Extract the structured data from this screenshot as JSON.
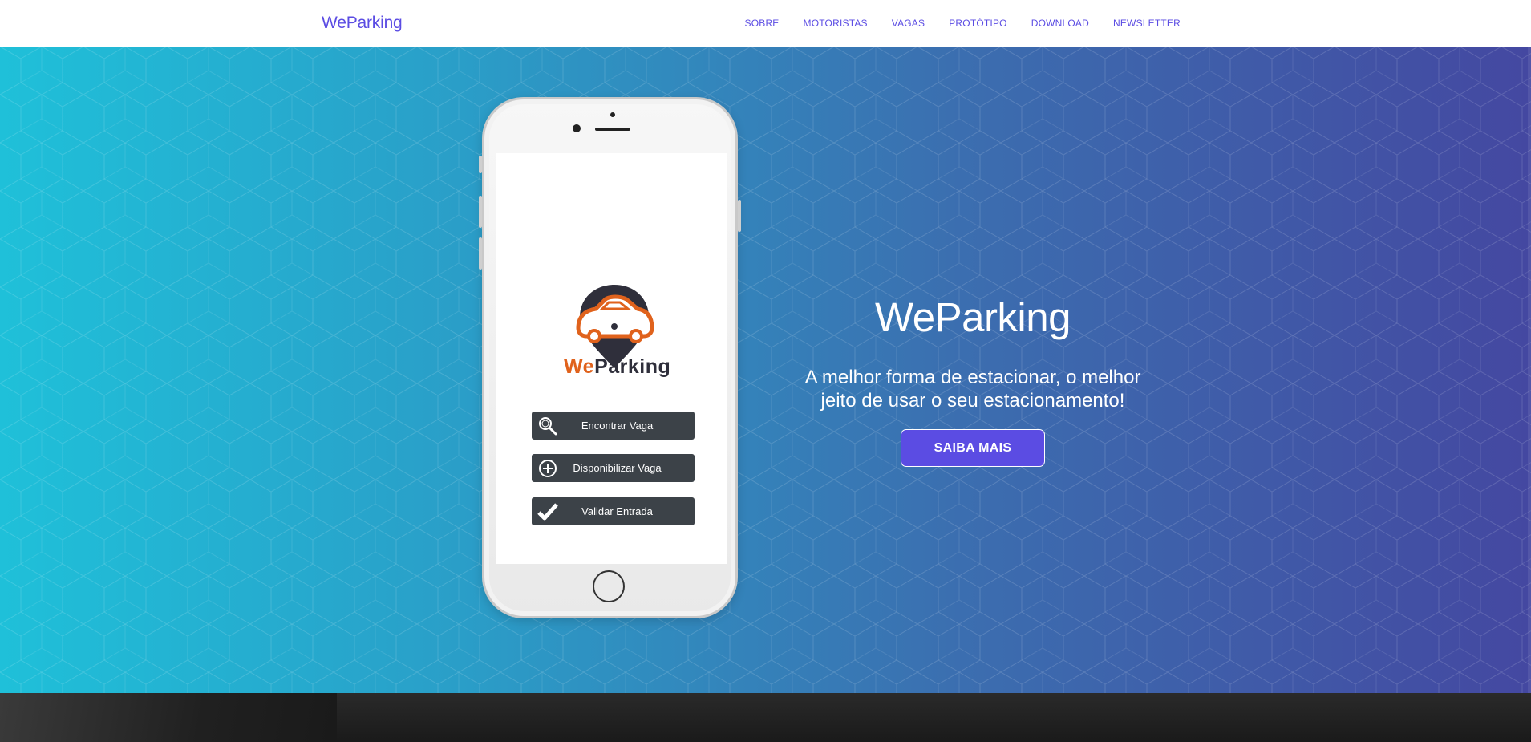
{
  "navbar": {
    "brand": "WeParking",
    "links": [
      "SOBRE",
      "MOTORISTAS",
      "VAGAS",
      "PROTÓTIPO",
      "DOWNLOAD",
      "NEWSLETTER"
    ]
  },
  "phone": {
    "logo_we": "We",
    "logo_parking": "Parking",
    "buttons": [
      {
        "label": "Encontrar Vaga",
        "icon": "search-icon"
      },
      {
        "label": "Disponibilizar Vaga",
        "icon": "plus-circle-icon"
      },
      {
        "label": "Validar Entrada",
        "icon": "check-icon"
      }
    ]
  },
  "hero": {
    "title": "WeParking",
    "subtitle": "A melhor forma de estacionar, o melhor jeito de usar o seu estacionamento!",
    "cta_label": "SAIBA MAIS"
  },
  "colors": {
    "brand": "#5b4ce3",
    "gradient_start": "#1fc0d9",
    "gradient_end": "#4448a1",
    "logo_orange": "#e0621c",
    "app_button": "#3c4248"
  }
}
